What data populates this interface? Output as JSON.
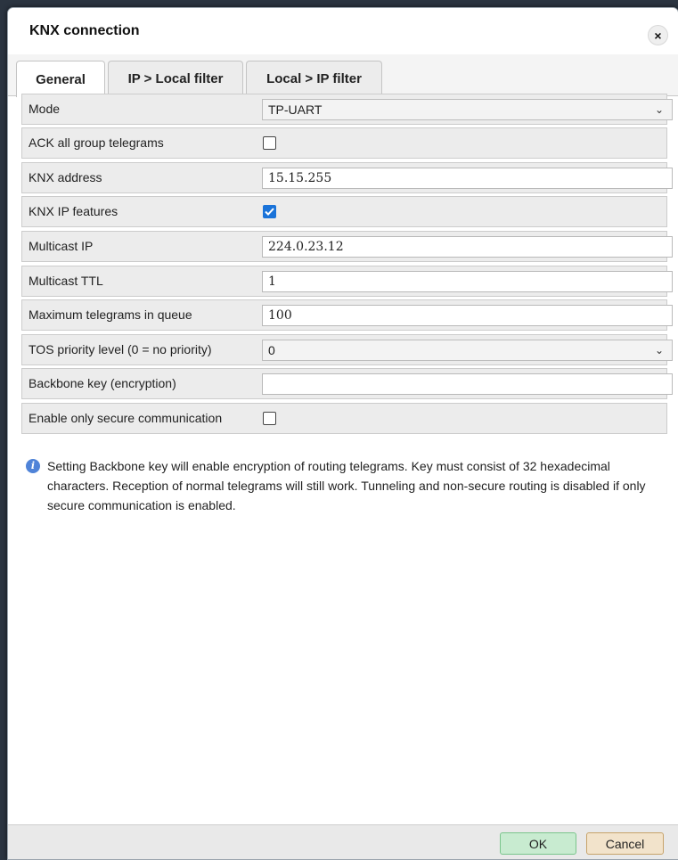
{
  "dialog": {
    "title": "KNX connection",
    "close_icon": "×"
  },
  "tabs": [
    {
      "label": "General",
      "active": true
    },
    {
      "label": "IP > Local filter",
      "active": false
    },
    {
      "label": "Local > IP filter",
      "active": false
    }
  ],
  "form": {
    "mode": {
      "label": "Mode",
      "value": "TP-UART"
    },
    "ack_all": {
      "label": "ACK all group telegrams",
      "checked": false
    },
    "knx_address": {
      "label": "KNX address",
      "value": "15.15.255"
    },
    "knx_ip_features": {
      "label": "KNX IP features",
      "checked": true
    },
    "multicast_ip": {
      "label": "Multicast IP",
      "value": "224.0.23.12"
    },
    "multicast_ttl": {
      "label": "Multicast TTL",
      "value": "1"
    },
    "max_telegrams": {
      "label": "Maximum telegrams in queue",
      "value": "100"
    },
    "tos_priority": {
      "label": "TOS priority level (0 = no priority)",
      "value": "0"
    },
    "backbone_key": {
      "label": "Backbone key (encryption)",
      "value": ""
    },
    "secure_only": {
      "label": "Enable only secure communication",
      "checked": false
    }
  },
  "info": {
    "icon": "info-icon",
    "text": "Setting Backbone key will enable encryption of routing telegrams. Key must consist of 32 hexadecimal characters. Reception of normal telegrams will still work. Tunneling and non-secure routing is disabled if only secure communication is enabled."
  },
  "footer": {
    "ok_label": "OK",
    "cancel_label": "Cancel"
  },
  "colors": {
    "checkbox_checked": "#1a73d9",
    "ok_button": "#c8ebd0",
    "cancel_button": "#f2e3cb"
  }
}
